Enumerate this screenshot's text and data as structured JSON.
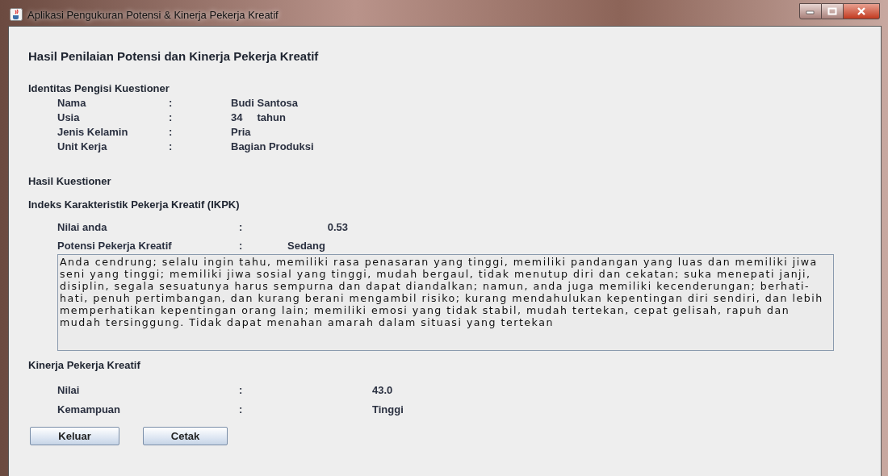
{
  "window": {
    "title": "Aplikasi Pengukuran Potensi & Kinerja Pekerja Kreatif"
  },
  "heading": "Hasil Penilaian Potensi dan Kinerja Pekerja Kreatif",
  "identity": {
    "title": "Identitas Pengisi Kuestioner",
    "rows": [
      {
        "label": "Nama",
        "colon": ":",
        "value": "Budi Santosa"
      },
      {
        "label": "Usia",
        "colon": ":",
        "value": "34",
        "unit": "tahun"
      },
      {
        "label": "Jenis Kelamin",
        "colon": ":",
        "value": "Pria"
      },
      {
        "label": "Unit Kerja",
        "colon": ":",
        "value": "Bagian Produksi"
      }
    ]
  },
  "results_title": "Hasil Kuestioner",
  "ikpk": {
    "title": "Indeks Karakteristik Pekerja Kreatif (IKPK)",
    "rows": [
      {
        "label": "Nilai anda",
        "colon": ":",
        "value": "0.53"
      },
      {
        "label": "Potensi Pekerja Kreatif",
        "colon": ":",
        "value": "Sedang"
      }
    ],
    "description": "Anda cendrung; selalu ingin tahu, memiliki rasa penasaran yang tinggi, memiliki pandangan yang luas dan memiliki jiwa seni yang tinggi; memiliki jiwa sosial yang tinggi, mudah bergaul, tidak menutup diri dan cekatan; suka menepati janji, disiplin, segala sesuatunya harus sempurna dan dapat diandalkan; namun, anda juga memiliki kecenderungan; berhati-hati, penuh pertimbangan, dan kurang berani mengambil risiko; kurang mendahulukan kepentingan diri sendiri, dan lebih memperhatikan kepentingan orang lain; memiliki emosi yang tidak stabil, mudah tertekan, cepat gelisah, rapuh dan mudah tersinggung. Tidak dapat menahan amarah dalam situasi yang tertekan"
  },
  "performance": {
    "title": "Kinerja Pekerja Kreatif",
    "rows": [
      {
        "label": "Nilai",
        "colon": ":",
        "value": "43.0"
      },
      {
        "label": "Kemampuan",
        "colon": ":",
        "value": "Tinggi"
      }
    ]
  },
  "buttons": [
    "Keluar",
    "Cetak"
  ]
}
